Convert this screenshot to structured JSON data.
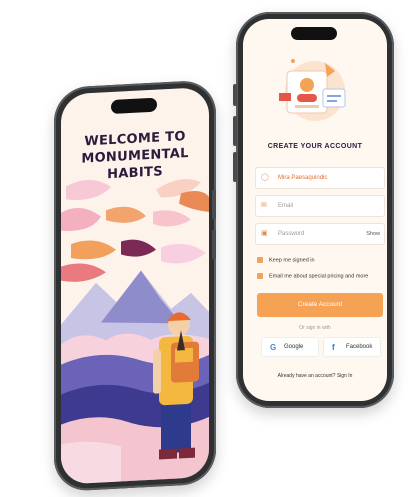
{
  "left_screen": {
    "title_line1": "WELCOME TO",
    "title_line2": "MONUMENTAL",
    "title_line3": "HABITS"
  },
  "right_screen": {
    "title": "CREATE YOUR ACCOUNT",
    "name_value": "Mira Paesaquindic",
    "email_placeholder": "Email",
    "password_placeholder": "Password",
    "show_label": "Show",
    "keep_signed_in": "Keep me signed in",
    "email_pricing": "Email me about special pricing and more",
    "create_button": "Create Account",
    "or_sign_in": "Or sign in with",
    "google_label": "Google",
    "facebook_label": "Facebook",
    "signin_prompt": "Already have an account? Sign In"
  },
  "colors": {
    "accent": "#f5a254",
    "title_text": "#2b1b3d",
    "phone_body": "#2f3032"
  }
}
